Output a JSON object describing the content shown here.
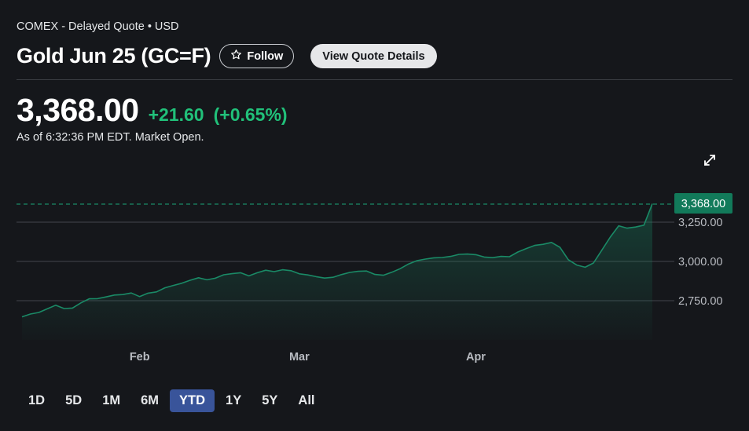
{
  "header": {
    "exchange": "COMEX - Delayed Quote • USD",
    "title": "Gold Jun 25 (GC=F)",
    "follow_label": "Follow",
    "quote_details_label": "View Quote Details"
  },
  "quote": {
    "price": "3,368.00",
    "change": "+21.60",
    "change_pct": "(+0.65%)",
    "as_of": "As of 6:32:36 PM EDT. Market Open."
  },
  "ranges": [
    {
      "label": "1D",
      "active": false
    },
    {
      "label": "5D",
      "active": false
    },
    {
      "label": "1M",
      "active": false
    },
    {
      "label": "6M",
      "active": false
    },
    {
      "label": "YTD",
      "active": true
    },
    {
      "label": "1Y",
      "active": false
    },
    {
      "label": "5Y",
      "active": false
    },
    {
      "label": "All",
      "active": false
    }
  ],
  "colors": {
    "line": "#1a8a66",
    "positive": "#21c17a",
    "current_badge": "#127a5a",
    "grid": "#3a3d43"
  },
  "chart_data": {
    "type": "area",
    "x_ticks": [
      {
        "label": "Feb",
        "index": 14
      },
      {
        "label": "Mar",
        "index": 33
      },
      {
        "label": "Apr",
        "index": 54
      }
    ],
    "y_ticks": [
      2750,
      3000,
      3250
    ],
    "y_tick_labels": [
      "2,750.00",
      "3,000.00",
      "3,250.00"
    ],
    "current_value": 3368,
    "current_label": "3,368.00",
    "values": [
      2647,
      2665,
      2675,
      2698,
      2721,
      2700,
      2703,
      2736,
      2762,
      2763,
      2774,
      2786,
      2789,
      2799,
      2776,
      2798,
      2806,
      2832,
      2847,
      2861,
      2880,
      2896,
      2883,
      2893,
      2915,
      2922,
      2928,
      2908,
      2928,
      2944,
      2935,
      2947,
      2941,
      2921,
      2914,
      2903,
      2894,
      2899,
      2916,
      2930,
      2937,
      2939,
      2917,
      2912,
      2931,
      2954,
      2984,
      3005,
      3015,
      3023,
      3025,
      3032,
      3045,
      3047,
      3043,
      3028,
      3024,
      3032,
      3030,
      3060,
      3082,
      3102,
      3109,
      3121,
      3090,
      3011,
      2977,
      2963,
      2990,
      3072,
      3155,
      3227,
      3212,
      3219,
      3231,
      3368
    ]
  }
}
